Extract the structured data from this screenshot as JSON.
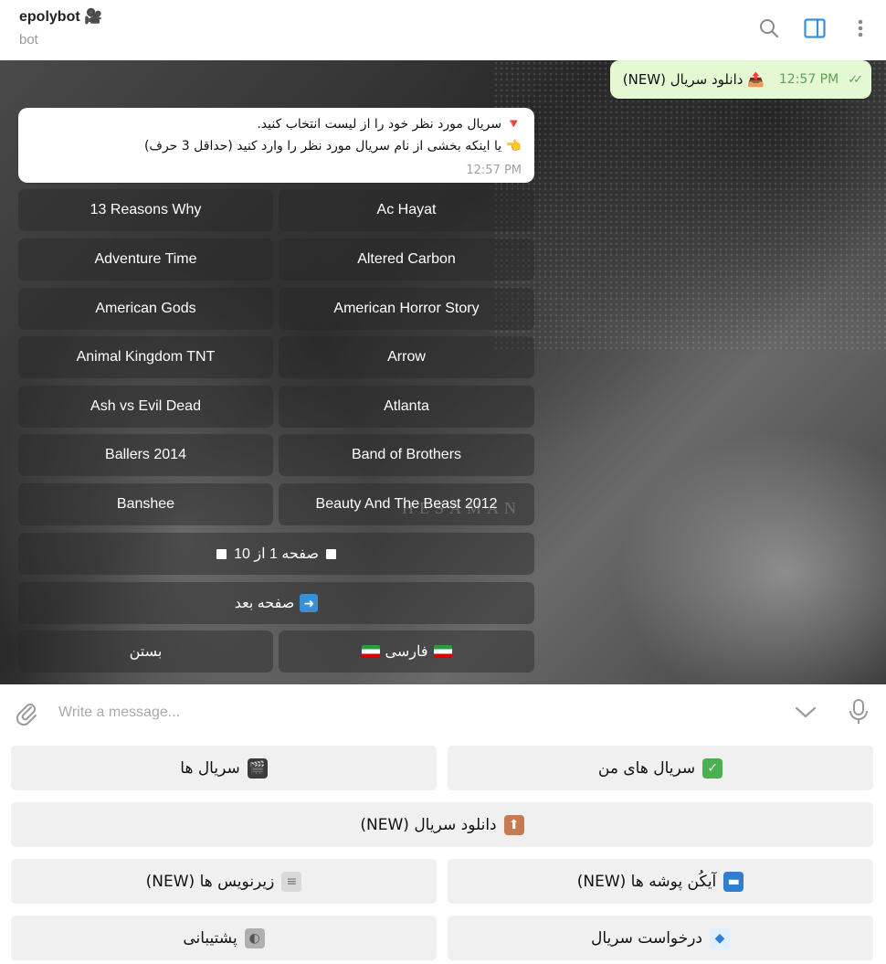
{
  "header": {
    "title": "epolybot 🎥",
    "subtitle": "bot"
  },
  "chat": {
    "outgoing": {
      "text": "📤 دانلود سریال (NEW)",
      "time": "12:57 PM"
    },
    "incoming": {
      "line1": "🔻 سریال مورد نظر خود را از لیست انتخاب کنید.",
      "line2": "👈 یا اینکه بخشی از نام سریال مورد نظر را وارد کنید (حداقل 3 حرف)",
      "time": "12:57 PM"
    },
    "watermark": "HESAMAN",
    "inline_keyboard": {
      "series": [
        "13 Reasons Why",
        "Ac Hayat",
        "Adventure Time",
        "Altered Carbon",
        "American Gods",
        "American Horror Story",
        "Animal Kingdom TNT",
        "Arrow",
        "Ash vs Evil Dead",
        "Atlanta",
        "Ballers 2014",
        "Band of Brothers",
        "Banshee",
        "Beauty And The Beast 2012"
      ],
      "page_indicator": "صفحه 1 از 10",
      "next_page": "صفحه بعد",
      "close": "بستن",
      "language": "فارسی"
    }
  },
  "input": {
    "placeholder": "Write a message..."
  },
  "reply_keyboard": {
    "series": "سریال ها",
    "my_series": "سریال های من",
    "download_series": "دانلود سریال (NEW)",
    "subtitles": "زیرنویس ها (NEW)",
    "covers": "آیکُن پوشه ها (NEW)",
    "support": "پشتیبانی",
    "request_series": "درخواست سریال"
  },
  "colors": {
    "accent": "#3a8fd9",
    "outgoing_bubble": "#e5f8d4",
    "time_green": "#5fa05a"
  }
}
